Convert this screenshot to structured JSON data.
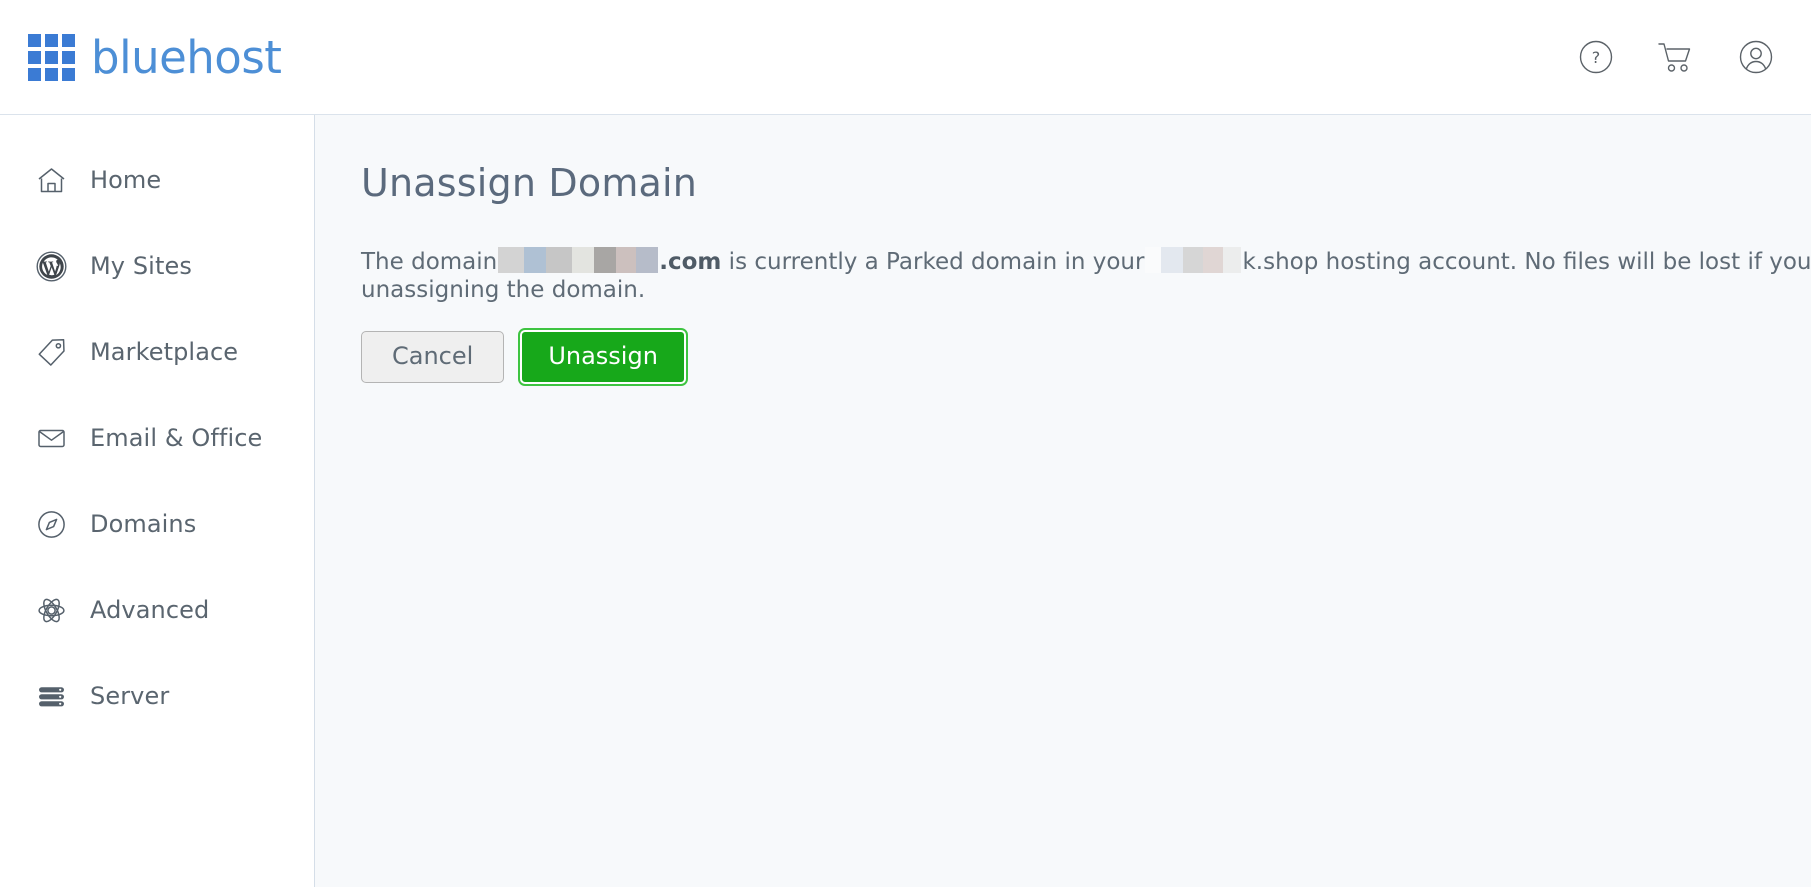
{
  "header": {
    "brand": "bluehost",
    "logo_color": "#3b7bd4",
    "wordmark_color": "#4d8fd6",
    "actions": [
      {
        "name": "help-icon",
        "label": "Help"
      },
      {
        "name": "cart-icon",
        "label": "Cart"
      },
      {
        "name": "account-icon",
        "label": "Account"
      }
    ]
  },
  "sidebar": {
    "items": [
      {
        "label": "Home",
        "icon": "home-icon"
      },
      {
        "label": "My Sites",
        "icon": "wordpress-icon"
      },
      {
        "label": "Marketplace",
        "icon": "tag-icon"
      },
      {
        "label": "Email & Office",
        "icon": "envelope-icon"
      },
      {
        "label": "Domains",
        "icon": "compass-icon"
      },
      {
        "label": "Advanced",
        "icon": "atom-icon"
      },
      {
        "label": "Server",
        "icon": "server-icon"
      }
    ]
  },
  "main": {
    "title": "Unassign Domain",
    "notice": {
      "part1": "The domain",
      "domain_redacted": "",
      "tld": ".com",
      "part2": " is currently a Parked domain in your",
      "account_redacted": "",
      "part3": "k.shop hosting account. No files will be lost if you continue unassigning the domain."
    },
    "buttons": {
      "cancel": "Cancel",
      "unassign": "Unassign",
      "unassign_color": "#17a81a",
      "unassign_focus_ring": "#3ec441"
    }
  }
}
